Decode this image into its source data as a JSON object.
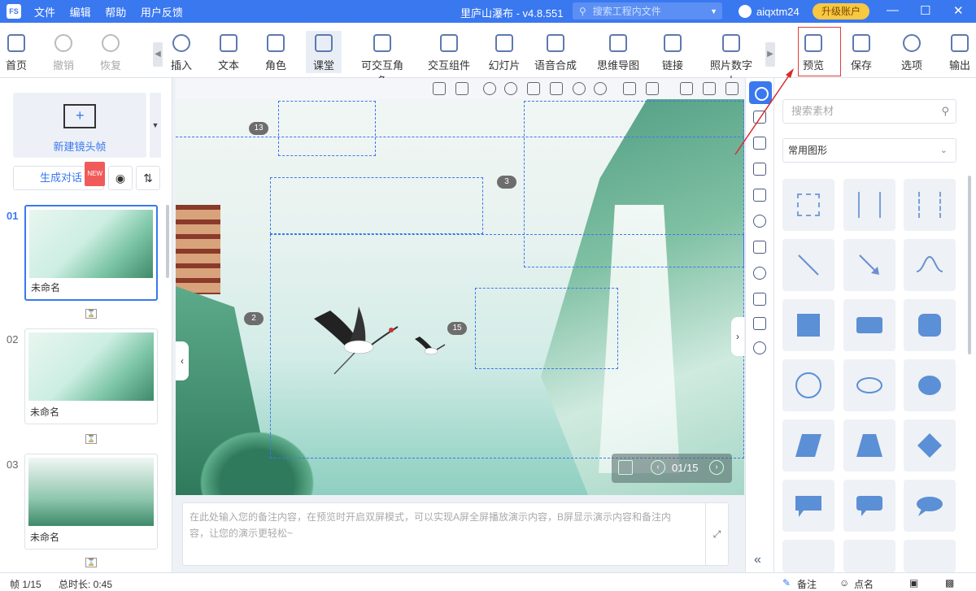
{
  "titlebar": {
    "logo": "FS",
    "menu": [
      "文件",
      "编辑",
      "帮助",
      "用户反馈"
    ],
    "title": "里庐山瀑布 - v4.8.551",
    "search_placeholder": "搜索工程内文件",
    "username": "aiqxtm24",
    "upgrade": "升级账户",
    "window_controls": [
      "minimize-icon",
      "maximize-icon",
      "close-icon"
    ]
  },
  "toolbar": {
    "home": "首页",
    "undo": "撤销",
    "redo": "恢复",
    "insert": "插入",
    "text": "文本",
    "role": "角色",
    "classroom": "课堂",
    "interactive_role": "可交互角色",
    "interactive_component": "交互组件",
    "slideshow": "幻灯片",
    "tts": "语音合成",
    "mindmap": "思维导图",
    "link": "链接",
    "photo_human": "照片数字人",
    "preview": "预览",
    "save": "保存",
    "options": "选项",
    "export": "输出"
  },
  "left": {
    "new_frame": "新建镜头帧",
    "gen_dialog": "生成对话",
    "new_badge": "NEW",
    "slides": [
      {
        "num": "01",
        "name": "未命名"
      },
      {
        "num": "02",
        "name": "未命名"
      },
      {
        "num": "03",
        "name": "未命名"
      }
    ]
  },
  "canvas": {
    "frame_labels": [
      "13",
      "3",
      "2",
      "15"
    ],
    "pager": "01/15"
  },
  "notes": {
    "placeholder": "在此处输入您的备注内容，在预览时开启双屏模式，可以实现A屏全屏播放演示内容，B屏显示演示内容和备注内容，让您的演示更轻松~"
  },
  "material": {
    "search_placeholder": "搜索素材",
    "category": "常用图形"
  },
  "status": {
    "frame": "帧 1/15",
    "duration": "总时长: 0:45",
    "notes": "备注",
    "rollcall": "点名"
  },
  "colors": {
    "brand": "#3a78f0",
    "highlight": "#e23a3a",
    "upgrade": "#f7c840"
  }
}
